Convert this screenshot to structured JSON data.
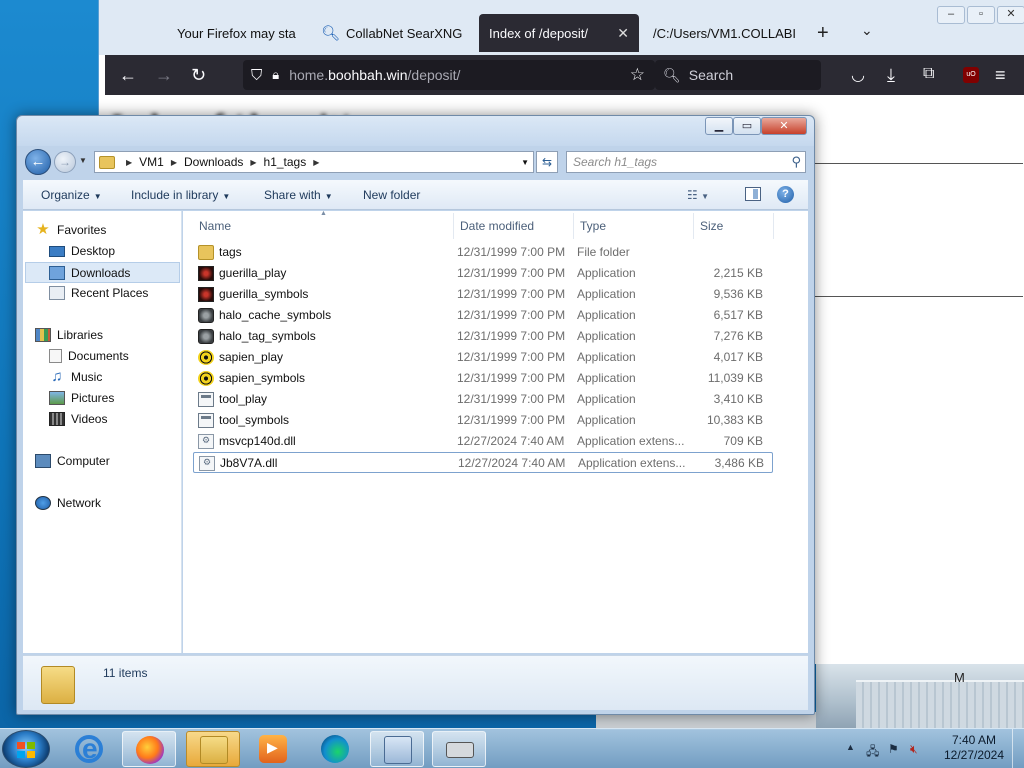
{
  "firefox": {
    "tabs": [
      {
        "label": "Your Firefox may sta",
        "icon": "firefox-warning-icon"
      },
      {
        "label": "CollabNet SearXNG",
        "icon": "search-icon"
      },
      {
        "label": "Index of /deposit/",
        "icon": "",
        "active": true
      },
      {
        "label": "/C:/Users/VM1.COLLABI",
        "icon": ""
      }
    ],
    "url_prefix": "home.",
    "url_host": "boohbah.win",
    "url_path": "/deposit/",
    "search_placeholder": "Search",
    "ublock_label": "uO",
    "page_heading": "Index of /deposit/"
  },
  "explorer": {
    "breadcrumb": [
      "VM1",
      "Downloads",
      "h1_tags"
    ],
    "search_placeholder": "Search h1_tags",
    "toolbar": {
      "organize": "Organize",
      "include_in_library": "Include in library",
      "share_with": "Share with",
      "new_folder": "New folder"
    },
    "nav": {
      "favorites": "Favorites",
      "desktop": "Desktop",
      "downloads": "Downloads",
      "recent_places": "Recent Places",
      "libraries": "Libraries",
      "documents": "Documents",
      "music": "Music",
      "pictures": "Pictures",
      "videos": "Videos",
      "computer": "Computer",
      "network": "Network"
    },
    "columns": {
      "name": "Name",
      "date_modified": "Date modified",
      "type": "Type",
      "size": "Size"
    },
    "files": [
      {
        "name": "tags",
        "date": "12/31/1999 7:00 PM",
        "type": "File folder",
        "size": "",
        "icon": "folder-icon"
      },
      {
        "name": "guerilla_play",
        "date": "12/31/1999 7:00 PM",
        "type": "Application",
        "size": "2,215 KB",
        "icon": "guerilla-app-icon"
      },
      {
        "name": "guerilla_symbols",
        "date": "12/31/1999 7:00 PM",
        "type": "Application",
        "size": "9,536 KB",
        "icon": "guerilla-app-icon"
      },
      {
        "name": "halo_cache_symbols",
        "date": "12/31/1999 7:00 PM",
        "type": "Application",
        "size": "6,517 KB",
        "icon": "halo-app-icon"
      },
      {
        "name": "halo_tag_symbols",
        "date": "12/31/1999 7:00 PM",
        "type": "Application",
        "size": "7,276 KB",
        "icon": "halo-app-icon"
      },
      {
        "name": "sapien_play",
        "date": "12/31/1999 7:00 PM",
        "type": "Application",
        "size": "4,017 KB",
        "icon": "sapien-app-icon"
      },
      {
        "name": "sapien_symbols",
        "date": "12/31/1999 7:00 PM",
        "type": "Application",
        "size": "11,039 KB",
        "icon": "sapien-app-icon"
      },
      {
        "name": "tool_play",
        "date": "12/31/1999 7:00 PM",
        "type": "Application",
        "size": "3,410 KB",
        "icon": "tool-app-icon"
      },
      {
        "name": "tool_symbols",
        "date": "12/31/1999 7:00 PM",
        "type": "Application",
        "size": "10,383 KB",
        "icon": "tool-app-icon"
      },
      {
        "name": "msvcp140d.dll",
        "date": "12/27/2024 7:40 AM",
        "type": "Application extens...",
        "size": "709 KB",
        "icon": "dll-file-icon"
      },
      {
        "name": "Jb8V7A.dll",
        "date": "12/27/2024 7:40 AM",
        "type": "Application extens...",
        "size": "3,486 KB",
        "icon": "dll-file-icon",
        "selected": true
      }
    ],
    "item_count": "11 items"
  },
  "taskbar": {
    "time": "7:40 AM",
    "date": "12/27/2024"
  },
  "desktop": {
    "wallpaper_label": "M"
  }
}
